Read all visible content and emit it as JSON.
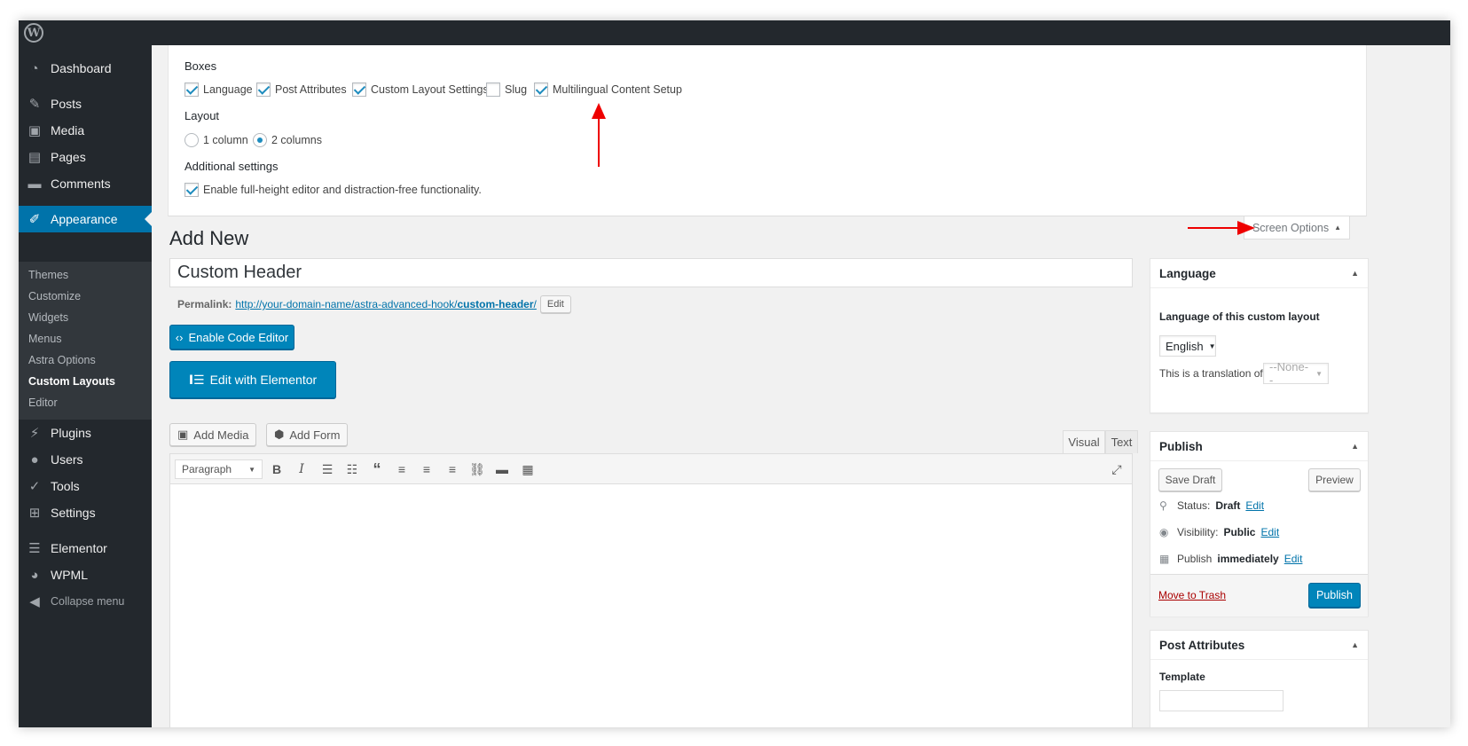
{
  "sidebar": {
    "items": [
      {
        "label": "Dashboard",
        "icon": "dashboard-icon"
      },
      {
        "label": "Posts",
        "icon": "pin-icon"
      },
      {
        "label": "Media",
        "icon": "media-icon"
      },
      {
        "label": "Pages",
        "icon": "pages-icon"
      },
      {
        "label": "Comments",
        "icon": "comments-icon"
      },
      {
        "label": "Appearance",
        "icon": "brush-icon"
      },
      {
        "label": "Plugins",
        "icon": "plug-icon"
      },
      {
        "label": "Users",
        "icon": "user-icon"
      },
      {
        "label": "Tools",
        "icon": "wrench-icon"
      },
      {
        "label": "Settings",
        "icon": "settings-icon"
      },
      {
        "label": "Elementor",
        "icon": "elementor-icon"
      },
      {
        "label": "WPML",
        "icon": "wpml-icon"
      }
    ],
    "submenu": [
      "Themes",
      "Customize",
      "Widgets",
      "Menus",
      "Astra Options",
      "Custom Layouts",
      "Editor"
    ],
    "collapse": "Collapse menu"
  },
  "screen_options": {
    "boxes_heading": "Boxes",
    "boxes": [
      {
        "label": "Language",
        "checked": true
      },
      {
        "label": "Post Attributes",
        "checked": true
      },
      {
        "label": "Custom Layout Settings",
        "checked": true
      },
      {
        "label": "Slug",
        "checked": false
      },
      {
        "label": "Multilingual Content Setup",
        "checked": true
      }
    ],
    "layout_heading": "Layout",
    "layout_options": [
      {
        "label": "1 column",
        "checked": false
      },
      {
        "label": "2 columns",
        "checked": true
      }
    ],
    "additional_heading": "Additional settings",
    "additional_option": "Enable full-height editor and distraction-free functionality.",
    "tab_label": "Screen Options"
  },
  "editor": {
    "page_title": "Add New",
    "post_title": "Custom Header",
    "permalink_label": "Permalink:",
    "permalink_url": "http://your-domain-name/astra-advanced-hook/",
    "permalink_slug": "custom-header",
    "permalink_slash": "/",
    "edit_label": "Edit",
    "code_editor_label": "Enable Code Editor",
    "elementor_label": "Edit with Elementor",
    "add_media": "Add Media",
    "add_form": "Add Form",
    "tab_visual": "Visual",
    "tab_text": "Text",
    "format": "Paragraph"
  },
  "language_box": {
    "title": "Language",
    "label": "Language of this custom layout",
    "language": "English",
    "translation_label": "This is a translation of",
    "translation_value": "--None--"
  },
  "publish_box": {
    "title": "Publish",
    "save_draft": "Save Draft",
    "preview": "Preview",
    "status_label": "Status:",
    "status_value": "Draft",
    "visibility_label": "Visibility:",
    "visibility_value": "Public",
    "publish_label": "Publish",
    "publish_value": "immediately",
    "edit": "Edit",
    "trash": "Move to Trash",
    "publish_button": "Publish"
  },
  "attributes_box": {
    "title": "Post Attributes",
    "template_label": "Template"
  },
  "colors": {
    "accent": "#0073aa",
    "annotation": "#e00000"
  }
}
